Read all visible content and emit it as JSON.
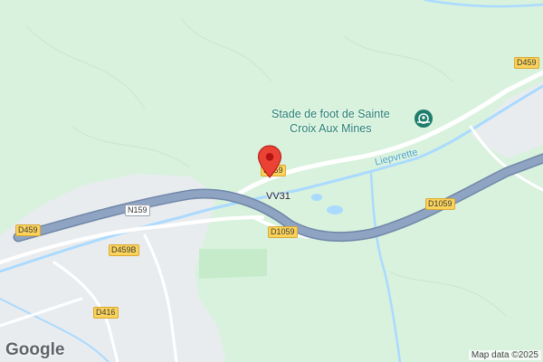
{
  "map": {
    "colors": {
      "land": "#d8f2dd",
      "urban": "#e9ecef",
      "highway": "#8fa4c2",
      "highway_outline": "#6f86a8",
      "local_road": "#ffffff",
      "river": "#aadaff",
      "marker": "#ea4335",
      "poi": "#1e7d6c",
      "route_label_bg": "#fbd35a"
    },
    "road_labels": [
      {
        "id": "d459-top",
        "text": "D459"
      },
      {
        "id": "d459-marker",
        "text": "D459"
      },
      {
        "id": "d1059-right",
        "text": "D1059"
      },
      {
        "id": "d1059-center",
        "text": "D1059"
      },
      {
        "id": "n159",
        "text": "N159"
      },
      {
        "id": "d459-left",
        "text": "D459"
      },
      {
        "id": "d459b",
        "text": "D459B"
      },
      {
        "id": "d416",
        "text": "D416"
      }
    ],
    "vv31_label": "VV31",
    "poi": {
      "name_line1": "Stade de foot de Sainte",
      "name_line2": "Croix Aux Mines",
      "icon": "soccer-stadium-icon"
    },
    "river_label": "Liepvrette",
    "marker": {
      "icon": "location-pin-icon"
    },
    "branding": {
      "logo_text": "Google",
      "attribution": "Map data ©2025"
    }
  }
}
